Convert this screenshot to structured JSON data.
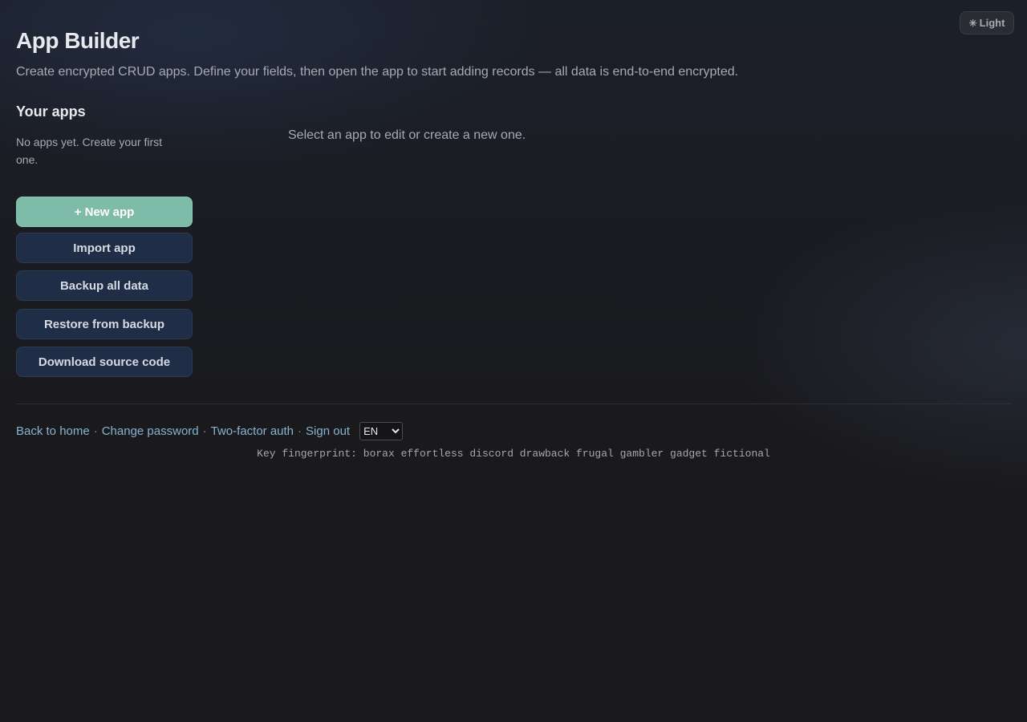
{
  "theme_toggle": {
    "icon": "sun-icon",
    "label": "Light"
  },
  "header": {
    "title": "App Builder",
    "subtitle": "Create encrypted CRUD apps. Define your fields, then open the app to start adding records — all data is end-to-end encrypted."
  },
  "sidebar": {
    "heading": "Your apps",
    "empty_note": "No apps yet. Create your first one.",
    "buttons": {
      "new_app": "+ New app",
      "import_app": "Import app",
      "backup_all": "Backup all data",
      "restore": "Restore from backup",
      "download_source": "Download source code"
    }
  },
  "main": {
    "hint": "Select an app to edit or create a new one."
  },
  "footer": {
    "links": [
      "Back to home",
      "Change password",
      "Two-factor auth",
      "Sign out"
    ],
    "separator": "·",
    "language": "EN",
    "fingerprint": "Key fingerprint: borax effortless discord drawback frugal gambler gadget fictional"
  },
  "colors": {
    "background": "#1a1a1d",
    "primary_button": "#7fbba9",
    "secondary_button": "#1f2d47",
    "link": "#86b3d3"
  }
}
